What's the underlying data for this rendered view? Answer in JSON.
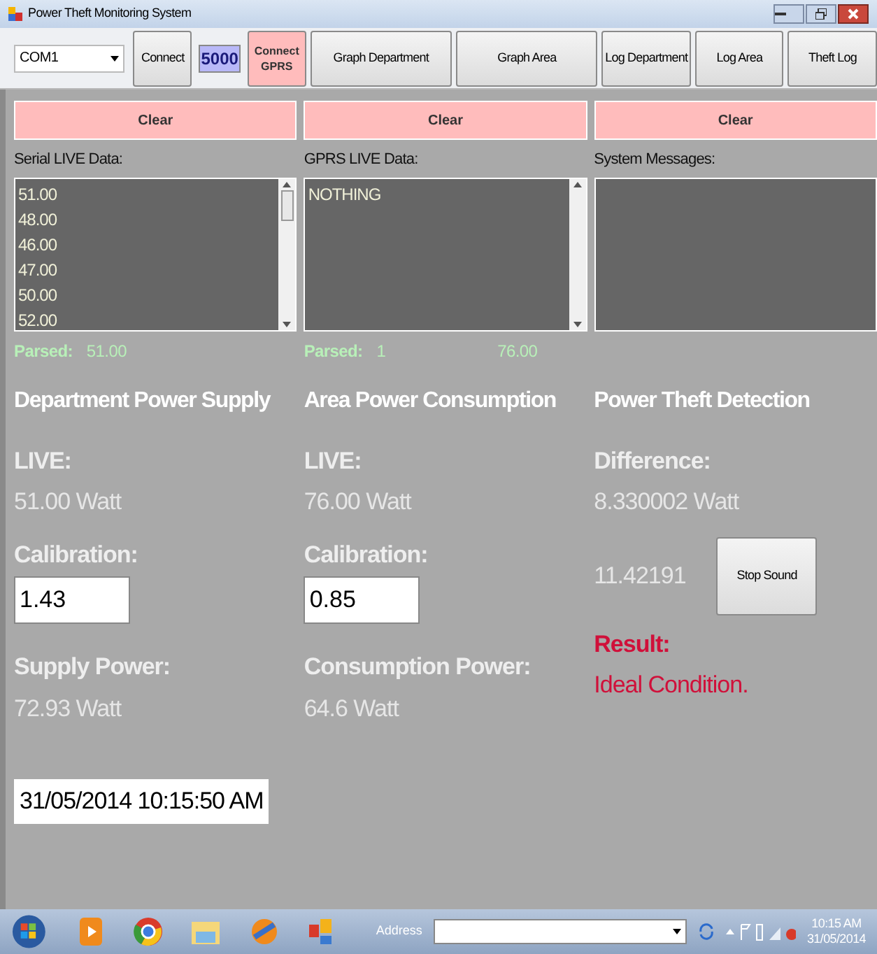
{
  "window": {
    "title": "Power Theft Monitoring System"
  },
  "toolbar": {
    "port": "COM1",
    "connect": "Connect",
    "number": "5000",
    "connect_gprs": "Connect GPRS",
    "buttons": [
      "Graph Department",
      "Graph Area",
      "Log Department",
      "Log Area",
      "Theft Log"
    ]
  },
  "panels": [
    {
      "clear": "Clear",
      "label": "Serial LIVE Data:",
      "lines": [
        "51.00",
        "48.00",
        "46.00",
        "47.00",
        "50.00",
        "52.00"
      ],
      "scrollbar": true,
      "parsed_label": "Parsed:",
      "parsed": [
        "51.00"
      ],
      "heading": "Department Power Supply"
    },
    {
      "clear": "Clear",
      "label": "GPRS LIVE Data:",
      "lines": [
        "NOTHING"
      ],
      "scrollbar": true,
      "parsed_label": "Parsed:",
      "parsed": [
        "1",
        "76.00"
      ],
      "heading": "Area Power Consumption"
    },
    {
      "clear": "Clear",
      "label": "System Messages:",
      "scrollbar": false,
      "heading": "Power Theft Detection"
    }
  ],
  "department": {
    "live_label": "LIVE:",
    "live": "51.00 Watt",
    "calibration_label": "Calibration:",
    "calibration": "1.43",
    "power_label": "Supply Power:",
    "power": "72.93 Watt"
  },
  "area": {
    "live_label": "LIVE:",
    "live": "76.00 Watt",
    "calibration_label": "Calibration:",
    "calibration": "0.85",
    "power_label": "Consumption Power:",
    "power": "64.6 Watt"
  },
  "theft": {
    "difference_label": "Difference:",
    "difference": "8.330002 Watt",
    "ratio": "11.42191",
    "stop_sound": "Stop Sound",
    "result_label": "Result:",
    "result": "Ideal Condition."
  },
  "timestamp": "31/05/2014 10:15:50 AM",
  "taskbar": {
    "address_label": "Address",
    "clock_time": "10:15 AM",
    "clock_date": "31/05/2014"
  }
}
